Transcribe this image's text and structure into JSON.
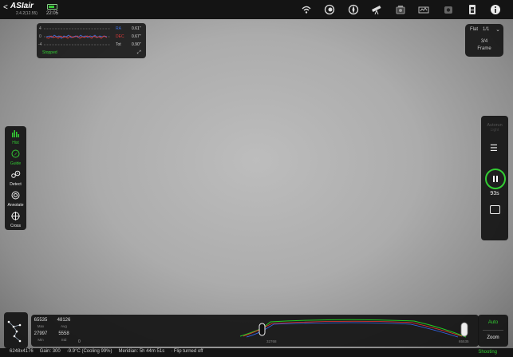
{
  "app": {
    "logo": "ASIair",
    "version": "2.4.2(12.55)",
    "time": "22:05",
    "back_glyph": "<"
  },
  "top_icons": [
    "wifi-icon",
    "display-icon",
    "mount-icon",
    "telescope-icon",
    "filter-wheel-icon",
    "focuser-icon",
    "camera-icon",
    "storage-icon",
    "info-icon"
  ],
  "guide_graph": {
    "ra_label": "RA",
    "dec_label": "DEC",
    "tot_label": "Tot",
    "ra_value": "0.61\"",
    "dec_value": "0.67\"",
    "tot_value": "0.90\"",
    "scale_top": "4",
    "scale_mid": "0",
    "scale_bot": "-4",
    "status": "Stopped",
    "colors": {
      "ra": "#3b6fe0",
      "dec": "#e03b3b",
      "status": "#33cc33"
    }
  },
  "frame_info": {
    "type": "Flat",
    "count": "1/1",
    "progress": "3/4",
    "label": "Frame"
  },
  "left_tools": [
    {
      "label": "Hist",
      "icon": "histogram-icon",
      "active": true
    },
    {
      "label": "Guide",
      "icon": "guide-icon",
      "active": true
    },
    {
      "label": "Detect",
      "icon": "detect-icon",
      "active": false
    },
    {
      "label": "Annotate",
      "icon": "annotate-icon",
      "active": false
    },
    {
      "label": "Cross",
      "icon": "crosshair-icon",
      "active": false
    }
  ],
  "right_panel": {
    "autorun": "Autorun",
    "autorun_sub": "Light",
    "exposure_seconds": "93s"
  },
  "histogram": {
    "max": "65535",
    "max_label": "Max",
    "avg": "48126",
    "avg_label": "Avg",
    "min": "27997",
    "min_label": "Min",
    "std": "5558",
    "std_label": "Std",
    "zero": "0",
    "mid": "32768",
    "top": "65535",
    "auto": "Auto",
    "zoom": "Zoom"
  },
  "status": {
    "resolution": "6248x4176",
    "gain": "Gain: 300",
    "temp": "-9.9°C (Cooling 99%)",
    "meridian": "Meridian: 5h 44m 51s",
    "flip": "· Flip turned off",
    "state": "Shooting"
  }
}
